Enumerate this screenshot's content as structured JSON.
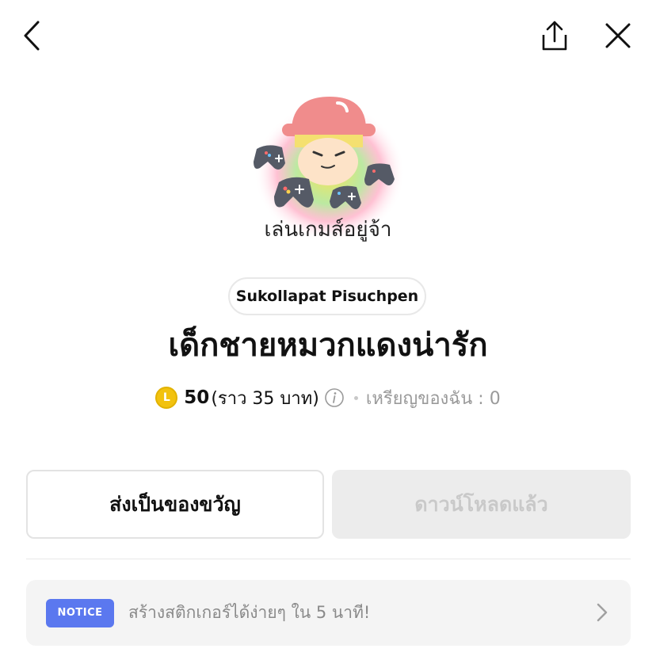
{
  "topbar": {
    "back_icon": "chevron-left-icon",
    "share_icon": "share-icon",
    "close_icon": "close-icon"
  },
  "sticker": {
    "caption": "เล่นเกมส์อยู่จ้า"
  },
  "author": "Sukollapat Pisuchpen",
  "title": "เด็กชายหมวกแดงน่ารัก",
  "price": {
    "coin_letter": "L",
    "amount": "50",
    "approx": "(ราว 35 บาท)",
    "my_coins": "เหรียญของฉัน : 0"
  },
  "buttons": {
    "gift": "ส่งเป็นของขวัญ",
    "downloaded": "ดาวน์โหลดแล้ว"
  },
  "notice": {
    "badge": "NOTICE",
    "text": "สร้างสติกเกอร์ได้ง่ายๆ ใน 5 นาที!"
  },
  "colors": {
    "notice_badge": "#5b78ef",
    "coin": "#f2c20f",
    "hat": "#f08c8c"
  }
}
